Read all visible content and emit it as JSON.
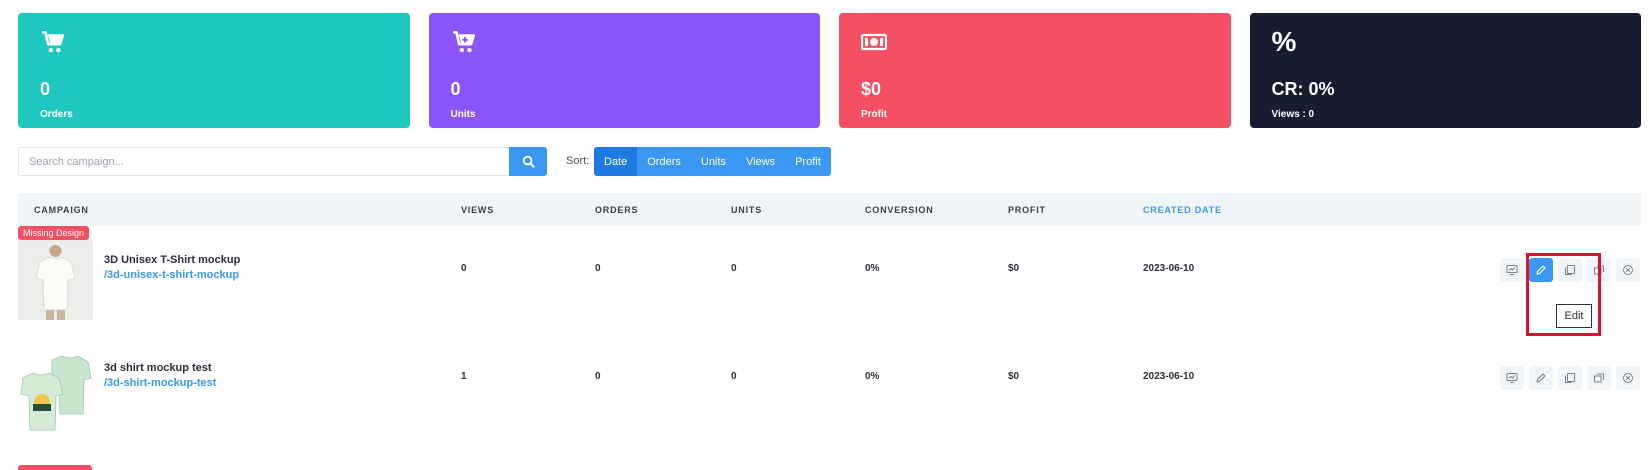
{
  "cards": {
    "orders": {
      "value": "0",
      "label": "Orders",
      "icon": "cart-icon",
      "color": "#1ec8be"
    },
    "units": {
      "value": "0",
      "label": "Units",
      "icon": "cart-plus-icon",
      "color": "#8c54fb"
    },
    "profit": {
      "value": "$0",
      "label": "Profit",
      "icon": "money-bill-icon",
      "color": "#f44f62"
    },
    "cr": {
      "symbol": "%",
      "value": "CR: 0%",
      "label": "Views : 0",
      "color": "#181c30"
    }
  },
  "search": {
    "placeholder": "Search campaign..."
  },
  "sort": {
    "label": "Sort:",
    "options": [
      "Date",
      "Orders",
      "Units",
      "Views",
      "Profit"
    ],
    "active": "Date"
  },
  "table": {
    "headers": [
      "CAMPAIGN",
      "VIEWS",
      "ORDERS",
      "UNITS",
      "CONVERSION",
      "PROFIT",
      "CREATED DATE"
    ],
    "active_header": "CREATED DATE",
    "rows": [
      {
        "badge": "Missing Design",
        "name": "3D Unisex T-Shirt mockup",
        "slug": "/3d-unisex-t-shirt-mockup",
        "views": "0",
        "orders": "0",
        "units": "0",
        "conversion": "0%",
        "profit": "$0",
        "created": "2023-06-10"
      },
      {
        "badge": "",
        "name": "3d shirt mockup test",
        "slug": "/3d-shirt-mockup-test",
        "views": "1",
        "orders": "0",
        "units": "0",
        "conversion": "0%",
        "profit": "$0",
        "created": "2023-06-10"
      }
    ]
  },
  "tooltip": {
    "text": "Edit"
  },
  "colors": {
    "accent": "#3a98f4",
    "danger": "#f44f62",
    "highlight": "#d9132d"
  }
}
